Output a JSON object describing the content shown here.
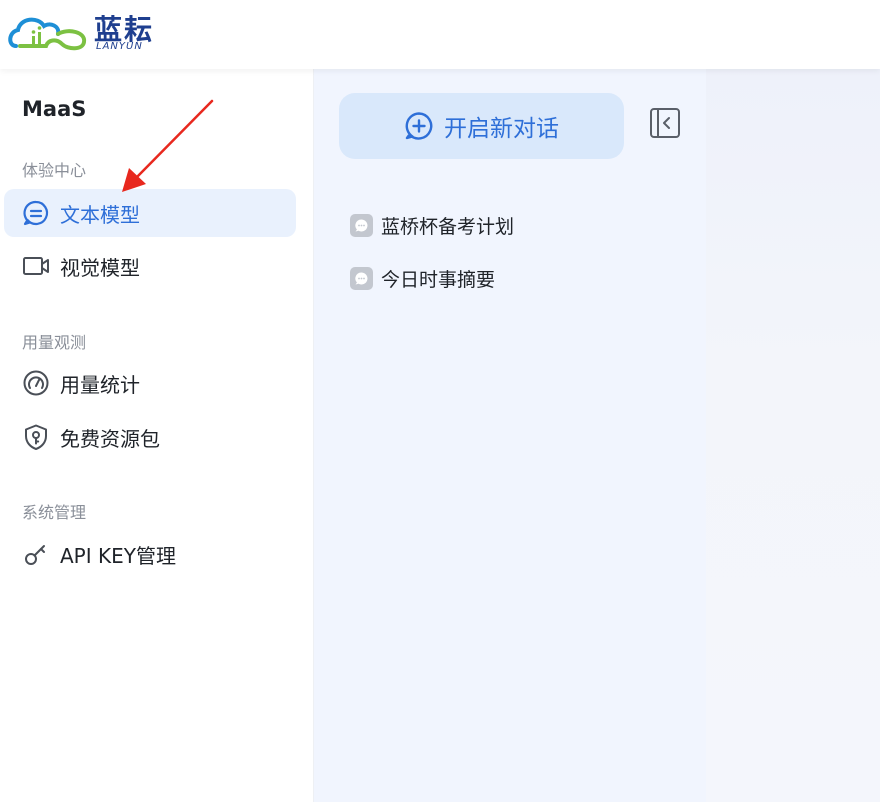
{
  "header": {
    "logo_cn": "蓝耘",
    "logo_en": "LANYUN",
    "brand_colors": {
      "blue": "#1e8fd6",
      "green": "#7cc142",
      "navy": "#1f3f8f"
    }
  },
  "sidebar": {
    "brand": "MaaS",
    "sections": [
      {
        "label": "体验中心",
        "items": [
          {
            "label": "文本模型",
            "icon": "chat-bubble-icon",
            "active": true
          },
          {
            "label": "视觉模型",
            "icon": "video-camera-icon",
            "active": false
          }
        ]
      },
      {
        "label": "用量观测",
        "items": [
          {
            "label": "用量统计",
            "icon": "gauge-icon",
            "active": false
          },
          {
            "label": "免费资源包",
            "icon": "shield-key-icon",
            "active": false
          }
        ]
      },
      {
        "label": "系统管理",
        "items": [
          {
            "label": "API KEY管理",
            "icon": "key-icon",
            "active": false
          }
        ]
      }
    ]
  },
  "chat_panel": {
    "new_chat_label": "开启新对话",
    "conversations": [
      {
        "title": "蓝桥杯备考计划"
      },
      {
        "title": "今日时事摘要"
      }
    ]
  },
  "colors": {
    "accent": "#2e6fd8",
    "active_bg": "#e9f1fd",
    "new_chat_bg": "#d9e8fb",
    "panel_bg": "#f1f5fe",
    "annotation_red": "#e8281e"
  }
}
